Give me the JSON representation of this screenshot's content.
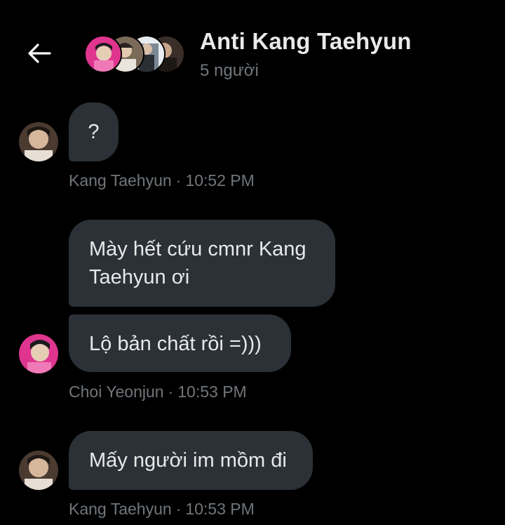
{
  "header": {
    "title": "Anti Kang Taehyun",
    "subtitle": "5 người"
  },
  "icons": {
    "back": "arrow-left-icon"
  },
  "colors": {
    "background": "#000000",
    "bubble": "#2b3136",
    "text": "#e7e9ea",
    "muted": "#71767b"
  },
  "messages": [
    {
      "text": "?",
      "sender": "Kang Taehyun",
      "time": "10:52 PM"
    },
    {
      "text": "Mày hết cứu cmnr Kang\nTaehyun ơi"
    },
    {
      "text": "Lộ bản chất rồi =)))",
      "sender": "Choi Yeonjun",
      "time": "10:53 PM"
    },
    {
      "text": "Mấy người im mồm đi",
      "sender": "Kang Taehyun",
      "time": "10:53 PM"
    }
  ],
  "meta_separator": "·"
}
